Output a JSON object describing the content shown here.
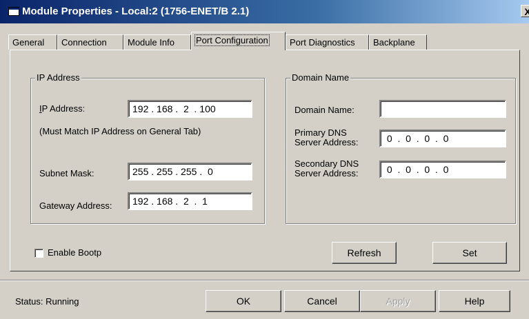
{
  "window": {
    "title": "Module Properties - Local:2 (1756-ENET/B 2.1)",
    "close_label": "X"
  },
  "tabs": [
    {
      "label": "General"
    },
    {
      "label": "Connection"
    },
    {
      "label": "Module Info"
    },
    {
      "label": "Port Configuration",
      "active": true
    },
    {
      "label": "Port Diagnostics"
    },
    {
      "label": "Backplane"
    }
  ],
  "ip_group": {
    "title": "IP Address",
    "ip_label": "IP Address:",
    "ip_value": "192 . 168 .  2  . 100",
    "note": "(Must Match IP Address on General Tab)",
    "subnet_label": "Subnet Mask:",
    "subnet_value": "255 . 255 . 255 .  0",
    "gateway_label": "Gateway Address:",
    "gateway_value": "192 . 168 .  2  .  1"
  },
  "domain_group": {
    "title": "Domain Name",
    "domain_label": "Domain Name:",
    "domain_value": "",
    "primary_label_1": "Primary DNS",
    "primary_label_2": "Server Address:",
    "primary_value": " 0  .  0  .  0  .  0",
    "secondary_label_1": "Secondary DNS",
    "secondary_label_2": "Server Address:",
    "secondary_value": " 0  .  0  .  0  .  0"
  },
  "bootp": {
    "label": "Enable Bootp",
    "checked": false
  },
  "buttons": {
    "refresh": "Refresh",
    "set": "Set",
    "ok": "OK",
    "cancel": "Cancel",
    "apply": "Apply",
    "help": "Help"
  },
  "status": {
    "text": "Status:  Running"
  }
}
